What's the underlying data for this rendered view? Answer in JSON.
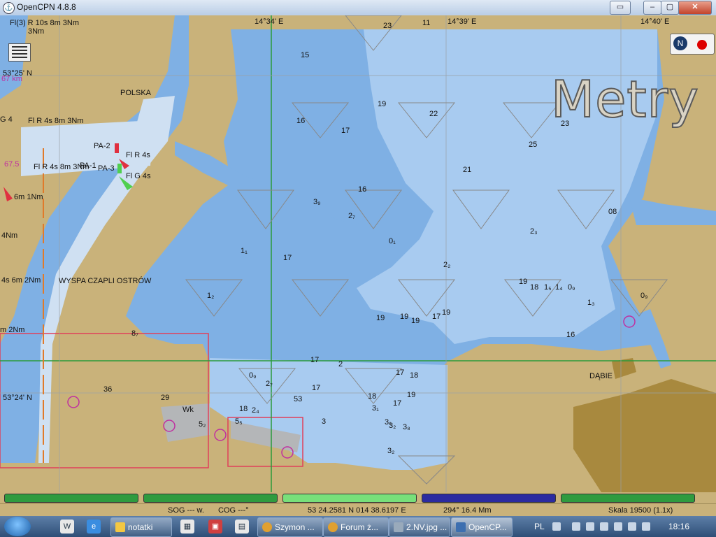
{
  "window": {
    "title": "OpenCPN 4.8.8",
    "icon": "opencpn-icon"
  },
  "chart": {
    "units_label": "Metry",
    "place_labels": {
      "polska": "POLSKA",
      "wyspa": "WYSPA CZAPLI OSTRÓW",
      "dabie": "DĄBIE",
      "wk": "Wk"
    },
    "light_labels": {
      "l1": "Fl(3) R 10s 8m 3Nm",
      "l1b": "3Nm",
      "l2": "Fl R 4s 8m 3Nm",
      "l3": "Fl R 4s 8m 3Nm",
      "l4": "Fl R 4s",
      "l5": "Fl G 4s",
      "l6": "6m 1Nm",
      "l7": "4Nm",
      "l8": "4s 6m 2Nm",
      "l9": "m 2Nm",
      "g4": "G 4",
      "pa2": "PA-2",
      "pa1": "PA-1",
      "pa3": "PA-3"
    },
    "grid_labels": {
      "lon1": "14°34' E",
      "lon2": "14°39' E",
      "lon3": "14°40' E",
      "lat1": "53°24' N",
      "lat2": "53°25' N"
    },
    "magenta_labels": {
      "m1": "67 km",
      "m2": "67.5"
    },
    "soundings": [
      "23",
      "11",
      "15",
      "19",
      "16",
      "22",
      "17",
      "23",
      "25",
      "21",
      "16",
      "3₉",
      "2₇",
      "0₁",
      "08",
      "2₃",
      "1₁",
      "17",
      "2₂",
      "1₂",
      "19",
      "18",
      "1₅",
      "1₄",
      "0₉",
      "1₃",
      "0₉",
      "19",
      "19",
      "19",
      "17",
      "19",
      "16",
      "8₇",
      "17",
      "0₉",
      "2₇",
      "17",
      "2",
      "17",
      "18",
      "36",
      "29",
      "5₂",
      "18",
      "2₄",
      "18",
      "17",
      "19",
      "3₁",
      "3₂",
      "3",
      "53",
      "3₁",
      "3₂",
      "3₈",
      "5₅"
    ]
  },
  "status_bars": {
    "colors": [
      "#2f9b3f",
      "#2f9b3f",
      "#78e07a",
      "#2b2ba0",
      "#2f9b3f"
    ]
  },
  "statusbar": {
    "sog": "SOG --- w.",
    "cog": "COG ---°",
    "position": "53 24.2581 N   014 38.6197 E",
    "bearing": "294°  16.4 Mm",
    "scale": "Skala 19500 (1.1x)"
  },
  "taskbar": {
    "items": [
      "notatki",
      "Szymon ...",
      "Forum ż...",
      "2.NV.jpg ...",
      "OpenCP..."
    ],
    "lang": "PL",
    "clock": "18:16"
  }
}
